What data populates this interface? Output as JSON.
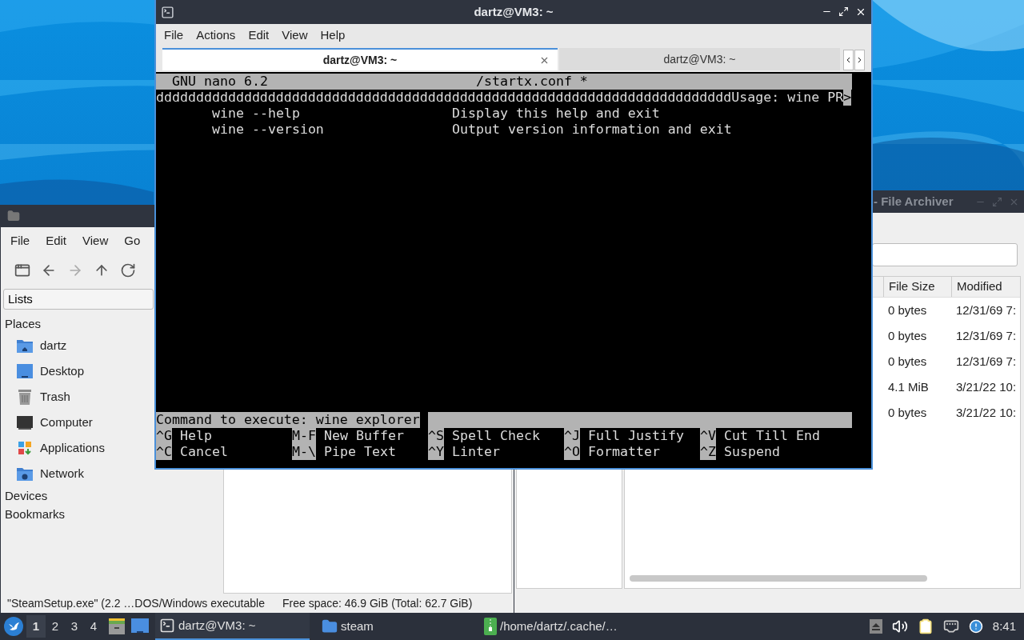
{
  "terminal": {
    "title": "dartz@VM3: ~",
    "menu": [
      "File",
      "Actions",
      "Edit",
      "View",
      "Help"
    ],
    "tabs": [
      {
        "label": "dartz@VM3: ~",
        "selected": true
      },
      {
        "label": "dartz@VM3: ~",
        "selected": false
      }
    ],
    "nano": {
      "header_left": "GNU nano 6.2",
      "header_file": "/startx.conf *",
      "status_line": {
        "text": "ddddddddddddddddddddddddddddddddddddddddddddddddddddddddddddddddddddddddUsage: wine PR",
        "overflow_mark": ">"
      },
      "help_rows": [
        {
          "option": "wine --help",
          "description": "Display this help and exit"
        },
        {
          "option": "wine --version",
          "description": "Output version information and exit"
        }
      ],
      "prompt": "Command to execute: wine explorer",
      "shortcuts": [
        {
          "key": "^G",
          "label": "Help"
        },
        {
          "key": "M-F",
          "label": "New Buffer"
        },
        {
          "key": "^S",
          "label": "Spell Check"
        },
        {
          "key": "^J",
          "label": "Full Justify"
        },
        {
          "key": "^V",
          "label": "Cut Till End"
        },
        {
          "key": "^C",
          "label": "Cancel"
        },
        {
          "key": "M-\\",
          "label": "Pipe Text"
        },
        {
          "key": "^Y",
          "label": "Linter"
        },
        {
          "key": "^O",
          "label": "Formatter"
        },
        {
          "key": "^Z",
          "label": "Suspend"
        }
      ]
    }
  },
  "file_manager": {
    "menu": [
      "File",
      "Edit",
      "View",
      "Go"
    ],
    "side_pane_mode": "Lists",
    "sections": [
      {
        "title": "Places",
        "items": [
          {
            "label": "dartz",
            "kind": "home"
          },
          {
            "label": "Desktop",
            "kind": "desktop"
          },
          {
            "label": "Trash",
            "kind": "trash"
          },
          {
            "label": "Computer",
            "kind": "computer"
          },
          {
            "label": "Applications",
            "kind": "applications"
          },
          {
            "label": "Network",
            "kind": "network"
          }
        ]
      },
      {
        "title": "Devices"
      },
      {
        "title": "Bookmarks"
      }
    ],
    "status_bar": {
      "selection": "\"SteamSetup.exe\" (2.2 …DOS/Windows executable",
      "free_space": "Free space: 46.9 GiB (Total: 62.7 GiB)"
    }
  },
  "archiver": {
    "title": "- File Archiver",
    "columns": [
      "File Size",
      "Modified"
    ],
    "rows": [
      {
        "size": "0 bytes",
        "modified": "12/31/69 7:"
      },
      {
        "size": "0 bytes",
        "modified": "12/31/69 7:"
      },
      {
        "size": "0 bytes",
        "modified": "12/31/69 7:"
      },
      {
        "size": "4.1 MiB",
        "modified": "3/21/22 10:"
      },
      {
        "size": "0 bytes",
        "modified": "3/21/22 10:"
      }
    ]
  },
  "taskbar": {
    "workspaces": [
      {
        "label": "1",
        "selected": true
      },
      {
        "label": "2",
        "selected": false
      },
      {
        "label": "3",
        "selected": false
      },
      {
        "label": "4",
        "selected": false
      }
    ],
    "tasks": [
      {
        "label": "dartz@VM3: ~",
        "kind": "terminal",
        "selected": true
      },
      {
        "label": "steam",
        "kind": "folder",
        "selected": false
      },
      {
        "label": "/home/dartz/.cache/…",
        "kind": "archive",
        "selected": false
      }
    ],
    "clock": "8:41"
  }
}
